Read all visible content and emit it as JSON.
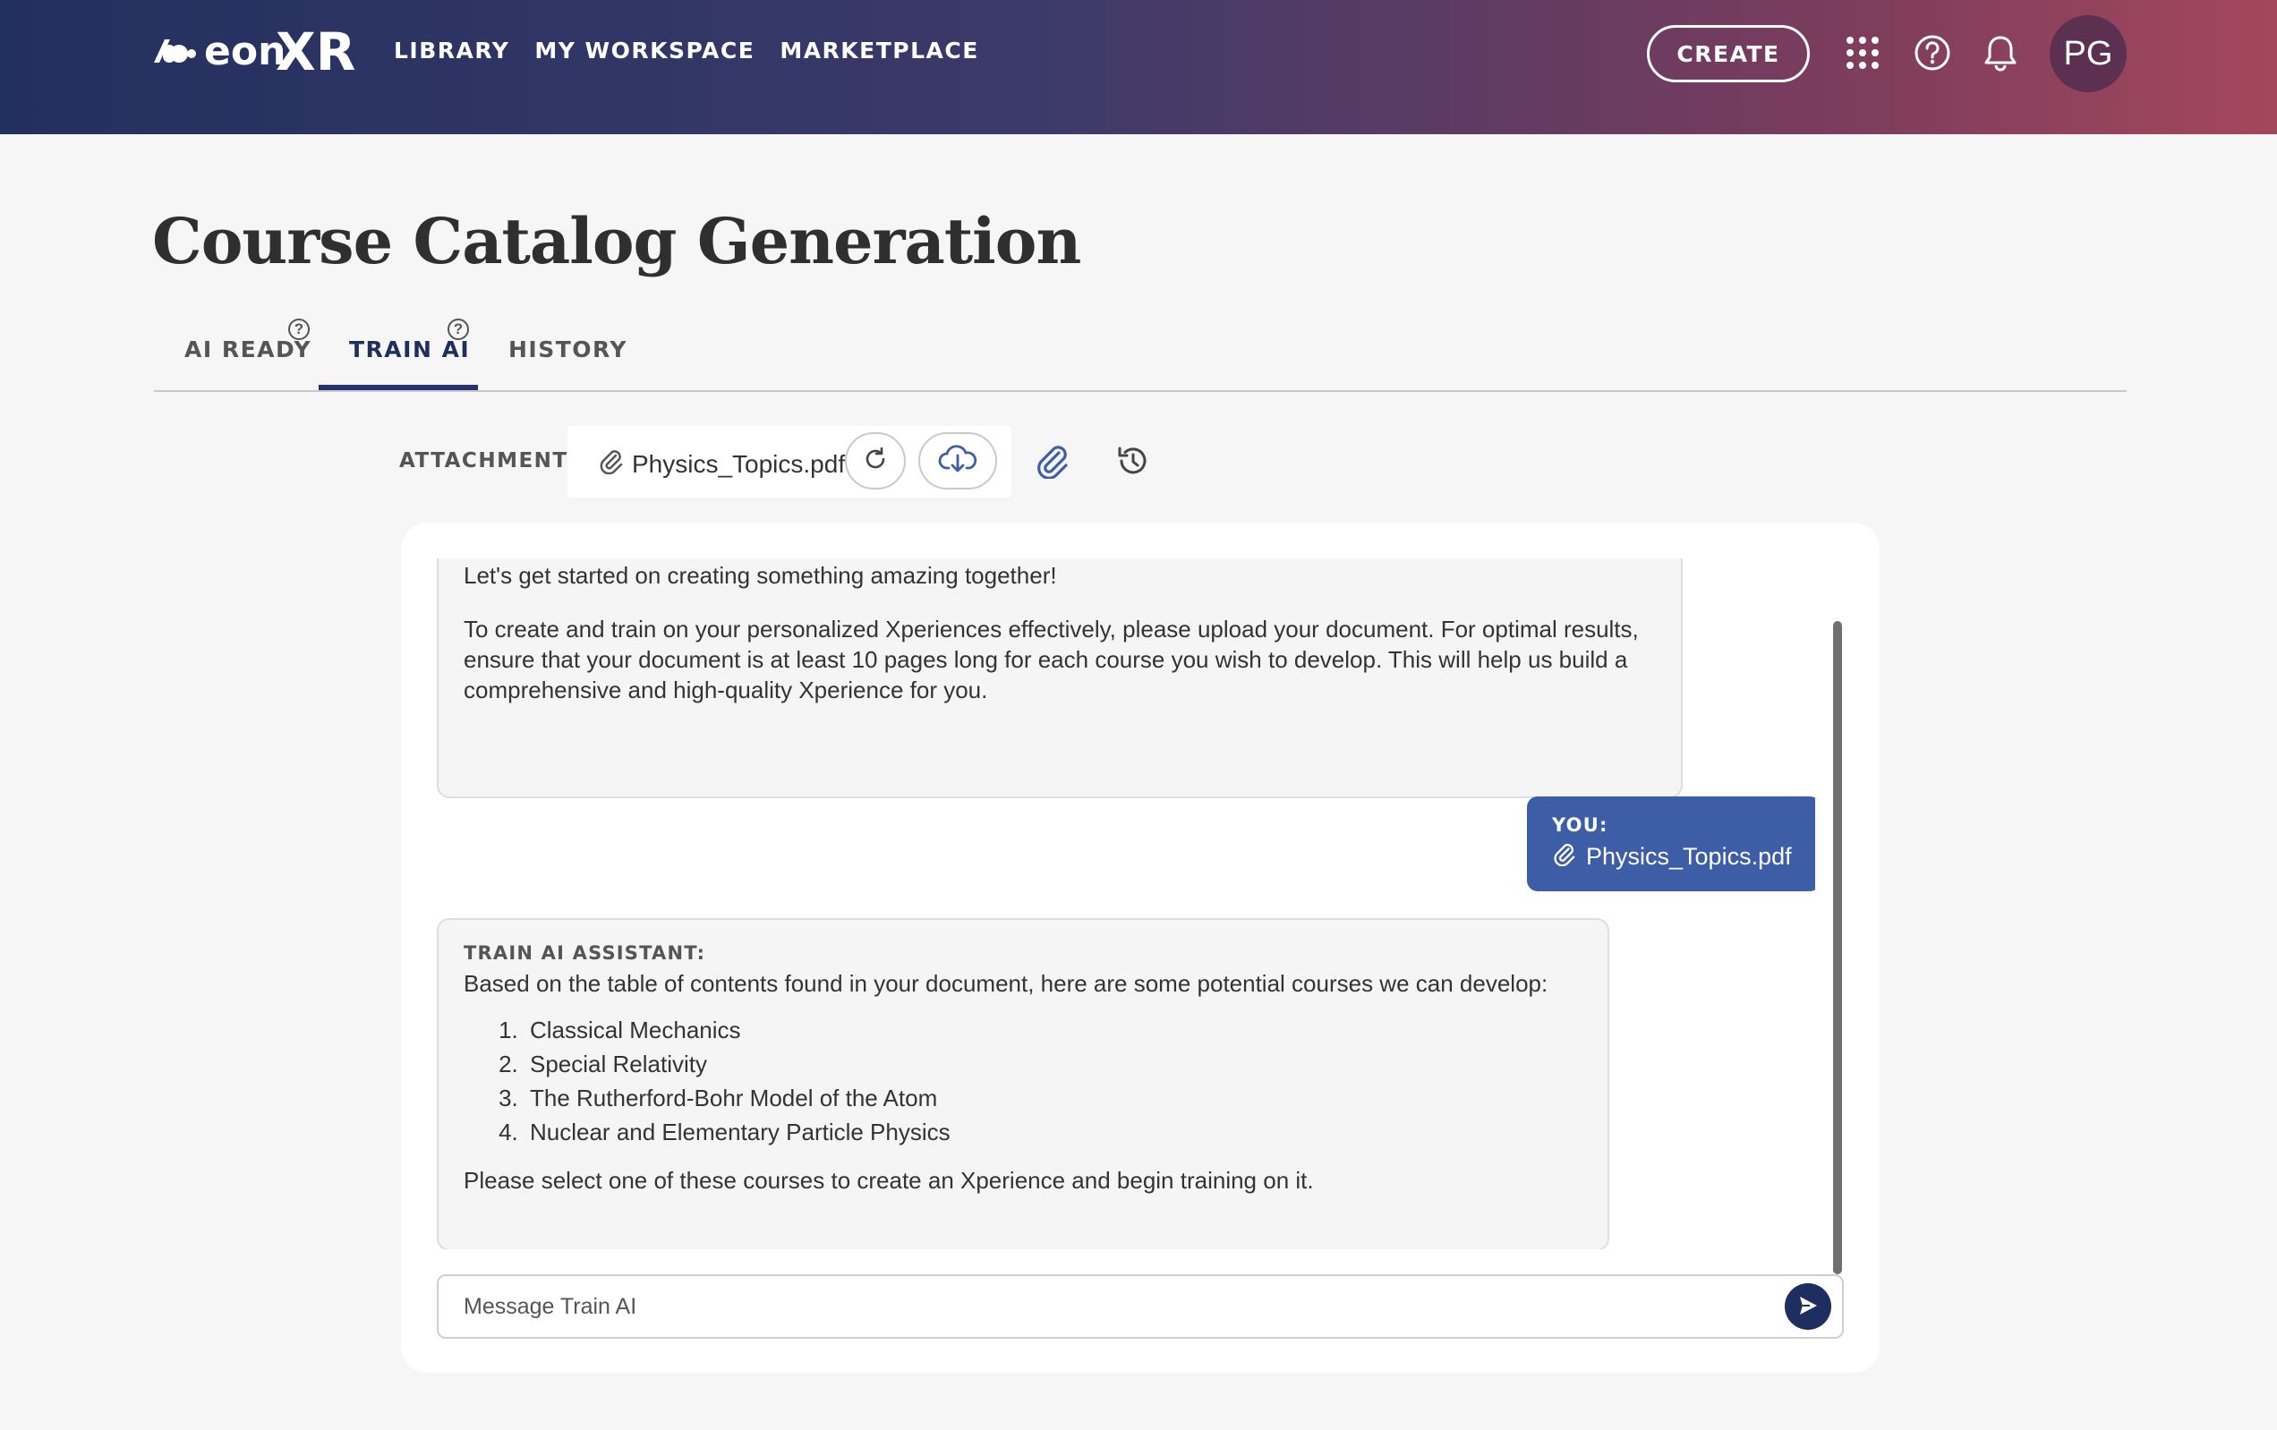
{
  "header": {
    "logo_text": "eonXR",
    "nav": [
      "LIBRARY",
      "MY WORKSPACE",
      "MARKETPLACE"
    ],
    "create_label": "CREATE",
    "avatar_initials": "PG",
    "icons": [
      "apps-grid-icon",
      "help-icon",
      "bell-icon"
    ]
  },
  "page": {
    "title": "Course Catalog Generation"
  },
  "tabs": [
    {
      "label": "AI READY",
      "help": "?"
    },
    {
      "label": "TRAIN AI",
      "help": "?",
      "active": true
    },
    {
      "label": "HISTORY"
    }
  ],
  "attachment": {
    "label": "ATTACHMENT",
    "file_name": "Physics_Topics.pdf",
    "icons": [
      "paperclip-icon",
      "refresh-icon",
      "cloud-download-icon",
      "attach-icon",
      "history-icon"
    ]
  },
  "chat": {
    "intro_start": "Let's get started on creating something amazing together!",
    "intro_upload": "To create and train on your personalized Xperiences effectively, please upload your document. For optimal results, ensure that your document is at least 10 pages long for each course you wish to develop. This will help us build a comprehensive and high-quality Xperience for you.",
    "user": {
      "label": "YOU:",
      "file_name": "Physics_Topics.pdf"
    },
    "assistant": {
      "label": "TRAIN AI ASSISTANT:",
      "intro": "Based on the table of contents found in your document, here are some potential courses we can develop:",
      "courses": [
        "Classical Mechanics",
        "Special Relativity",
        "The Rutherford-Bohr Model of the Atom",
        "Nuclear and Elementary Particle Physics"
      ],
      "outro": "Please select one of these courses to create an Xperience and begin training on it."
    },
    "input_placeholder": "Message Train AI"
  },
  "colors": {
    "header_gradient_start": "#22305f",
    "header_gradient_end": "#a4475c",
    "active_tab": "#24346a",
    "user_bubble": "#3d5ea6",
    "send_button": "#1d2e5f",
    "attach_icon": "#3d5ea6"
  }
}
